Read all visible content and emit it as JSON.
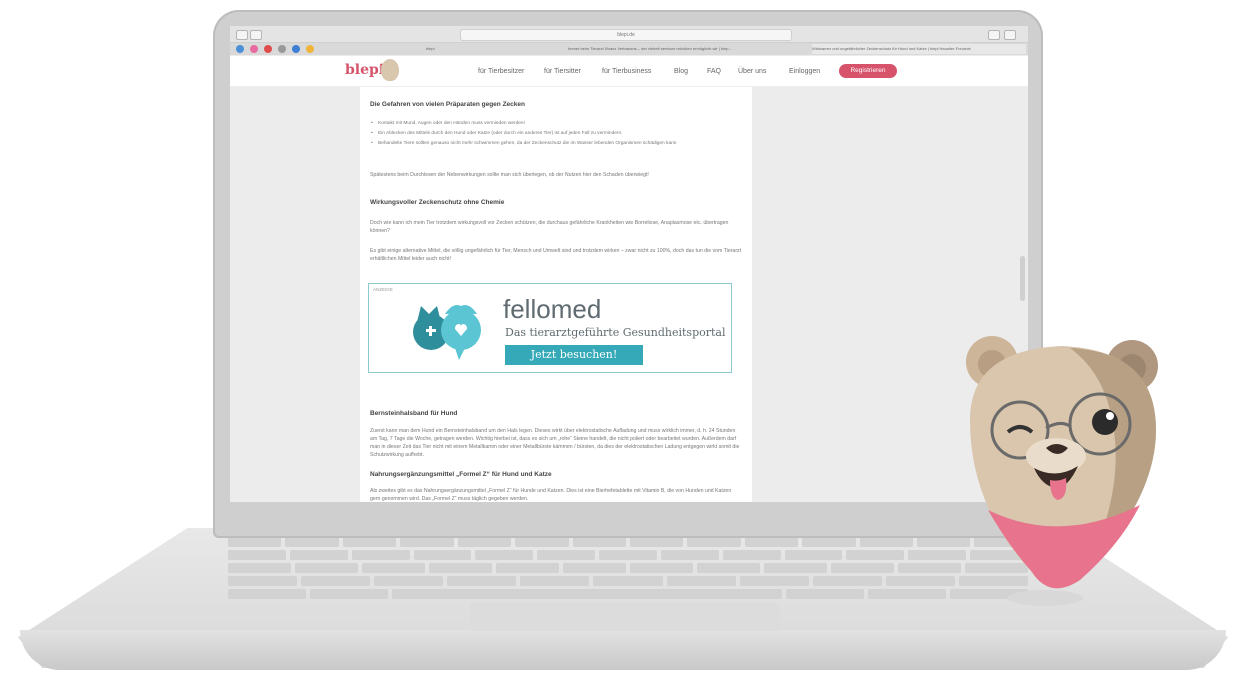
{
  "browser": {
    "url": "blepi.de",
    "tabs": [
      {
        "label": "blepi"
      },
      {
        "label": "Immer beim Tierarzt Ütrasz Vertrauens – der vielreit services möchten ermöglicht wir | blep…"
      },
      {
        "label": "Wirksamer und ungefährlicher Zeckenschutz für Hund und Katze | blepi Haustier-Freunde"
      }
    ]
  },
  "site": {
    "logo": "blepi",
    "nav": [
      "für Tierbesitzer",
      "für Tiersitter",
      "für Tierbusiness",
      "Blog",
      "FAQ",
      "Über uns",
      "Einloggen"
    ],
    "register": "Registrieren"
  },
  "article": {
    "heading1": "Die Gefahren von vielen Präparaten gegen Zecken",
    "bullets": [
      "Kontakt mit Mund, Augen oder den Händen muss vermieden werden!",
      "Ein Ablecken des Mittels durch den Hund oder Katze (oder durch ein anderes Tier) ist auf jeden Fall zu vermindern.",
      "Behandelte Tiere sollten genauso nicht mehr schwimmen gehen, da der Zeckenschutz die im Wasser lebenden Organismen schädigen kann"
    ],
    "para1": "Spätestens beim Durchlesen der Nebenwirkungen sollte man sich überlegen, ob der Nutzen hier den Schaden überwiegt!",
    "heading2": "Wirkungsvoller Zeckenschutz ohne Chemie",
    "para2": "Doch wie kann ich mein Tier trotzdem wirkungsvoll vor Zecken schützen, die durchaus gefährliche Krankheiten wie Borreliose, Anaplasmose etc. übertragen können?",
    "para3": "Es gibt einige alternative Mittel, die völlig ungefährlich für Tier, Mensch und Umwelt sind und trotzdem wirken – zwar nicht zu 100%, doch das tun die vom Tierarzt erhältlichen Mittel leider auch nicht!",
    "ad": {
      "label": "ANZEIGE",
      "brand": "fellomed",
      "tagline": "Das tierarztgeführte Gesundheitsportal",
      "cta": "Jetzt besuchen!"
    },
    "heading3": "Bernsteinhalsband für Hund",
    "para4": "Zuerst kann man dem Hund ein Bernsteinhalsband um den Hals legen. Dieses wirkt über elektrostatische Aufladung und muss wirklich immer, d. h. 24 Stunden am Tag, 7 Tage die Woche, getragen werden. Wichtig hierbei ist, dass es sich um „rohe“ Steine handelt, die nicht poliert oder bearbeitet wurden. Außerdem darf man in dieser Zeit das Tier nicht mit einem Metallkamm oder einer Metallbürste kämmen / bürsten, da dies der elektrostatischen Ladung entgegen wirkt somit die Schutzwirkung aufhebt.",
    "heading4": "Nahrungsergänzungsmittel „Formel Z“ für Hund und Katze",
    "para5": "Als zweites gibt es das Nahrungsergänzungsmittel „Formel Z“ für Hunde und Katzen. Dies ist eine Bierhefetablette mit Vitamin B, die von Hunden und Katzen gern genommen wird. Das „Formel Z“ muss täglich gegeben werden."
  }
}
